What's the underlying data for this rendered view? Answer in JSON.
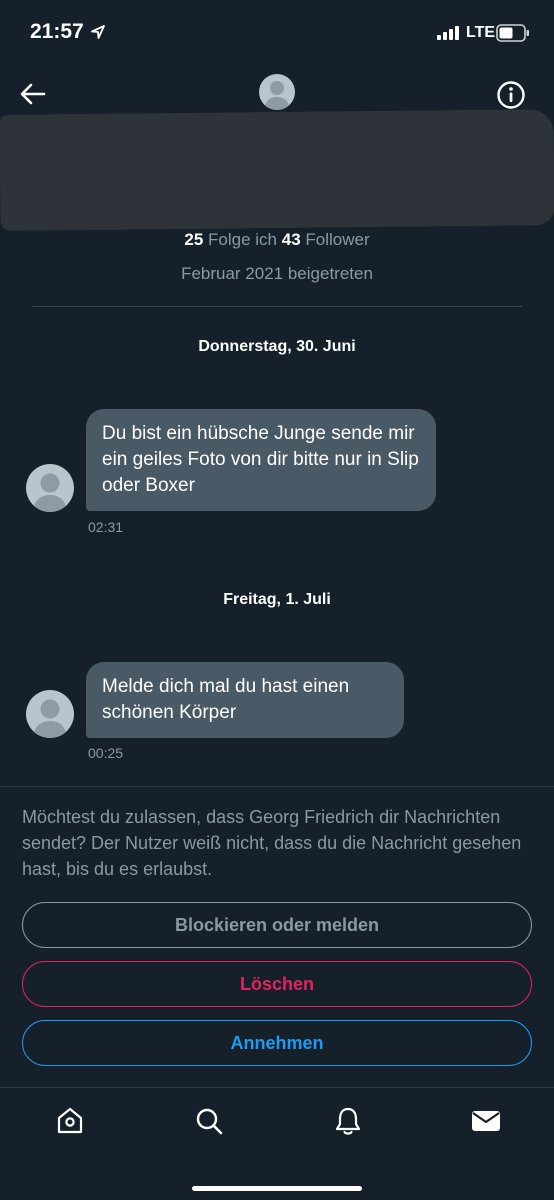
{
  "status_bar": {
    "time": "21:57",
    "network": "LTE"
  },
  "profile": {
    "following_count": "25",
    "following_label": "Folge ich",
    "followers_count": "43",
    "followers_label": "Follower",
    "joined": "Februar 2021 beigetreten"
  },
  "conversation": {
    "day1": "Donnerstag, 30. Juni",
    "message1_text": "Du bist ein hübsche Junge sende mir ein geiles Foto von dir bitte nur in Slip oder Boxer",
    "message1_time": "02:31",
    "day2": "Freitag, 1. Juli",
    "message2_text": "Melde dich mal du hast einen schönen Körper",
    "message2_time": "00:25"
  },
  "request": {
    "prompt": "Möchtest du zulassen, dass Georg Friedrich dir Nachrichten sendet? Der Nutzer weiß nicht, dass du die Nachricht gesehen hast, bis du es erlaubst.",
    "block_label": "Blockieren oder melden",
    "delete_label": "Löschen",
    "accept_label": "Annehmen"
  },
  "icons": {
    "back": "arrow-left-icon",
    "info": "info-icon",
    "tabs": [
      "home-icon",
      "search-icon",
      "bell-icon",
      "mail-icon"
    ]
  },
  "colors": {
    "background": "#15202b",
    "bubble": "#4a5966",
    "secondary_text": "#8b98a5",
    "delete": "#e0245e",
    "accept": "#1d9bf0"
  }
}
